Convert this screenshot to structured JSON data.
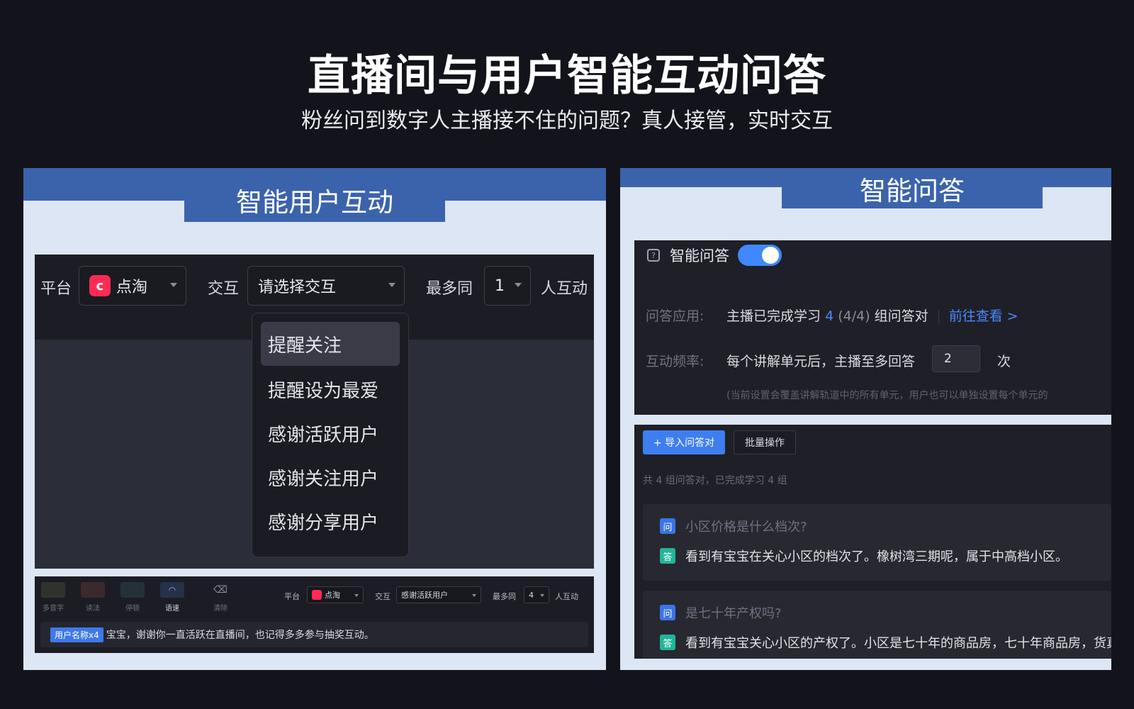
{
  "header": {
    "title": "直播间与用户智能互动问答",
    "subtitle": "粉丝问到数字人主播接不住的问题？真人接管，实时交互"
  },
  "left_panel": {
    "tab_title": "智能用户互动",
    "toolbar": {
      "platform_label": "平台",
      "platform_value": "点淘",
      "interaction_label": "交互",
      "interaction_placeholder": "请选择交互",
      "max_label": "最多同",
      "max_value": "1",
      "tail_label": "人互动"
    },
    "dropdown_options": [
      "提醒关注",
      "提醒设为最爱",
      "感谢活跃用户",
      "感谢关注用户",
      "感谢分享用户"
    ],
    "bottom": {
      "tools": [
        "多音字",
        "读法",
        "停顿",
        "语速",
        "清除"
      ],
      "platform_label": "平台",
      "platform_value": "点淘",
      "interaction_label": "交互",
      "interaction_value": "感谢活跃用户",
      "max_label": "最多同",
      "max_value": "4",
      "tail_label": "人互动",
      "message_tag": "用户名称x4",
      "message_text": "宝宝，谢谢你一直活跃在直播间，也记得多多参与抽奖互动。"
    },
    "colors": {
      "brand": "#ff2b55",
      "accent": "#3f78ea"
    }
  },
  "right_panel": {
    "tab_title": "智能问答",
    "settings": {
      "title": "智能问答",
      "app_label": "问答应用:",
      "app_text": "主播已完成学习",
      "app_count": "4",
      "app_ratio": "(4/4)",
      "app_suffix": "组问答对",
      "link": "前往查看 >",
      "freq_label": "互动频率:",
      "freq_text": "每个讲解单元后，主播至多回答",
      "freq_value": "2",
      "freq_unit": "次",
      "note": "(当前设置会覆盖讲解轨道中的所有单元，用户也可以单独设置每个单元的"
    },
    "list": {
      "import_button": "+ 导入问答对",
      "batch_button": "批量操作",
      "summary": "共 4 组问答对，已完成学习 4 组",
      "q_badge": "问",
      "a_badge": "答",
      "items": [
        {
          "q": "小区价格是什么档次?",
          "a": "看到有宝宝在关心小区的档次了。橡树湾三期呢，属于中高档小区。"
        },
        {
          "q": "是七十年产权吗?",
          "a": "看到有宝宝关心小区的产权了。小区是七十年的商品房，七十年商品房，货真价"
        }
      ]
    },
    "colors": {
      "toggle_on": "#3f88ff",
      "q_badge": "#3c74e6",
      "a_badge": "#22b59a"
    }
  }
}
